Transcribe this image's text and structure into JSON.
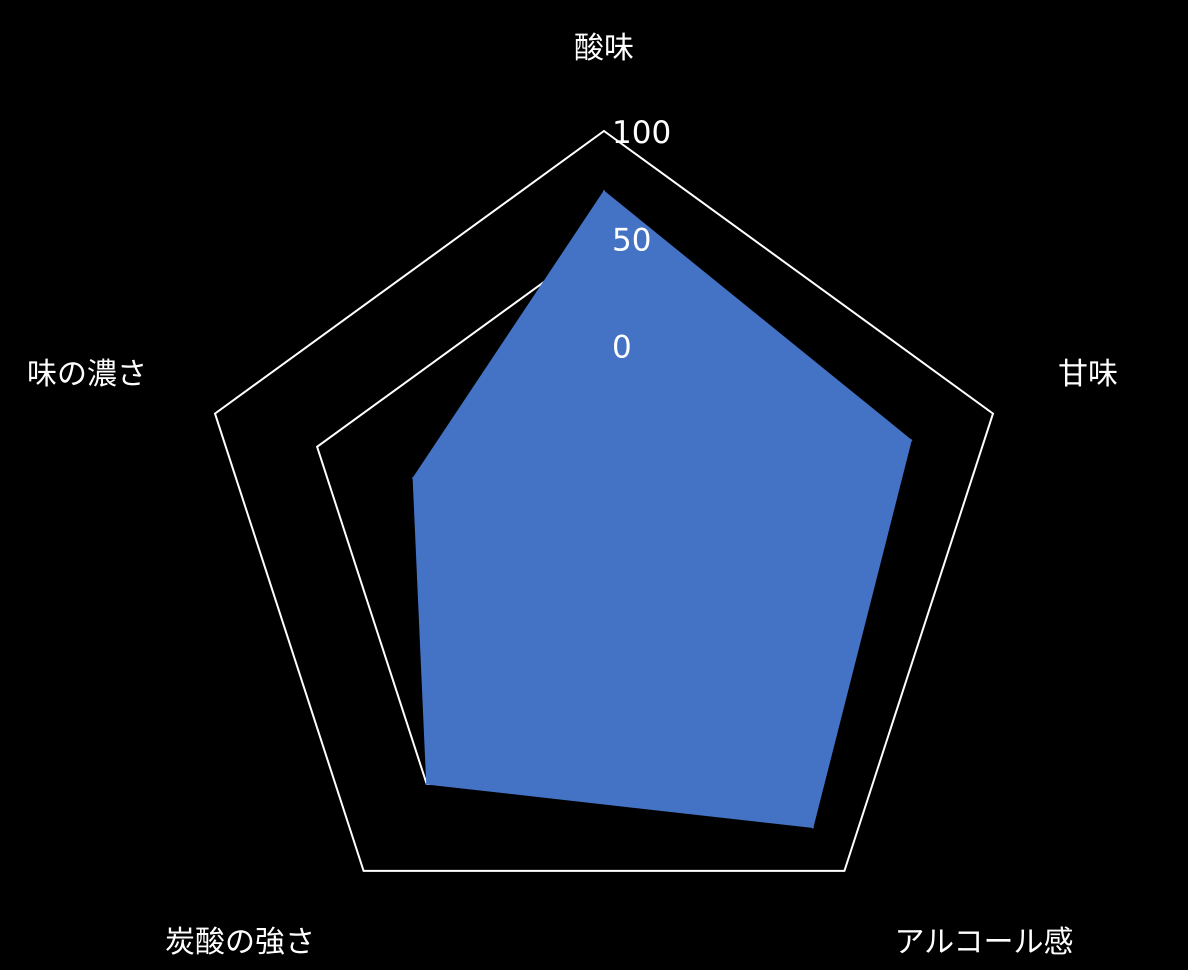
{
  "chart_data": {
    "type": "radar",
    "axes": [
      "酸味",
      "甘味",
      "アルコール感",
      "炭酸の強さ",
      "味の濃さ"
    ],
    "series": [
      {
        "values": [
          72,
          60,
          75,
          50,
          3
        ]
      }
    ],
    "rlim": [
      0,
      100
    ],
    "ticks": [
      0,
      50,
      100
    ],
    "tick_labels": [
      "0",
      "50",
      "100"
    ],
    "grid": true,
    "colors": {
      "background": "#000000",
      "grid": "#ffffff",
      "series": "#4472C4",
      "text": "#ffffff"
    }
  }
}
